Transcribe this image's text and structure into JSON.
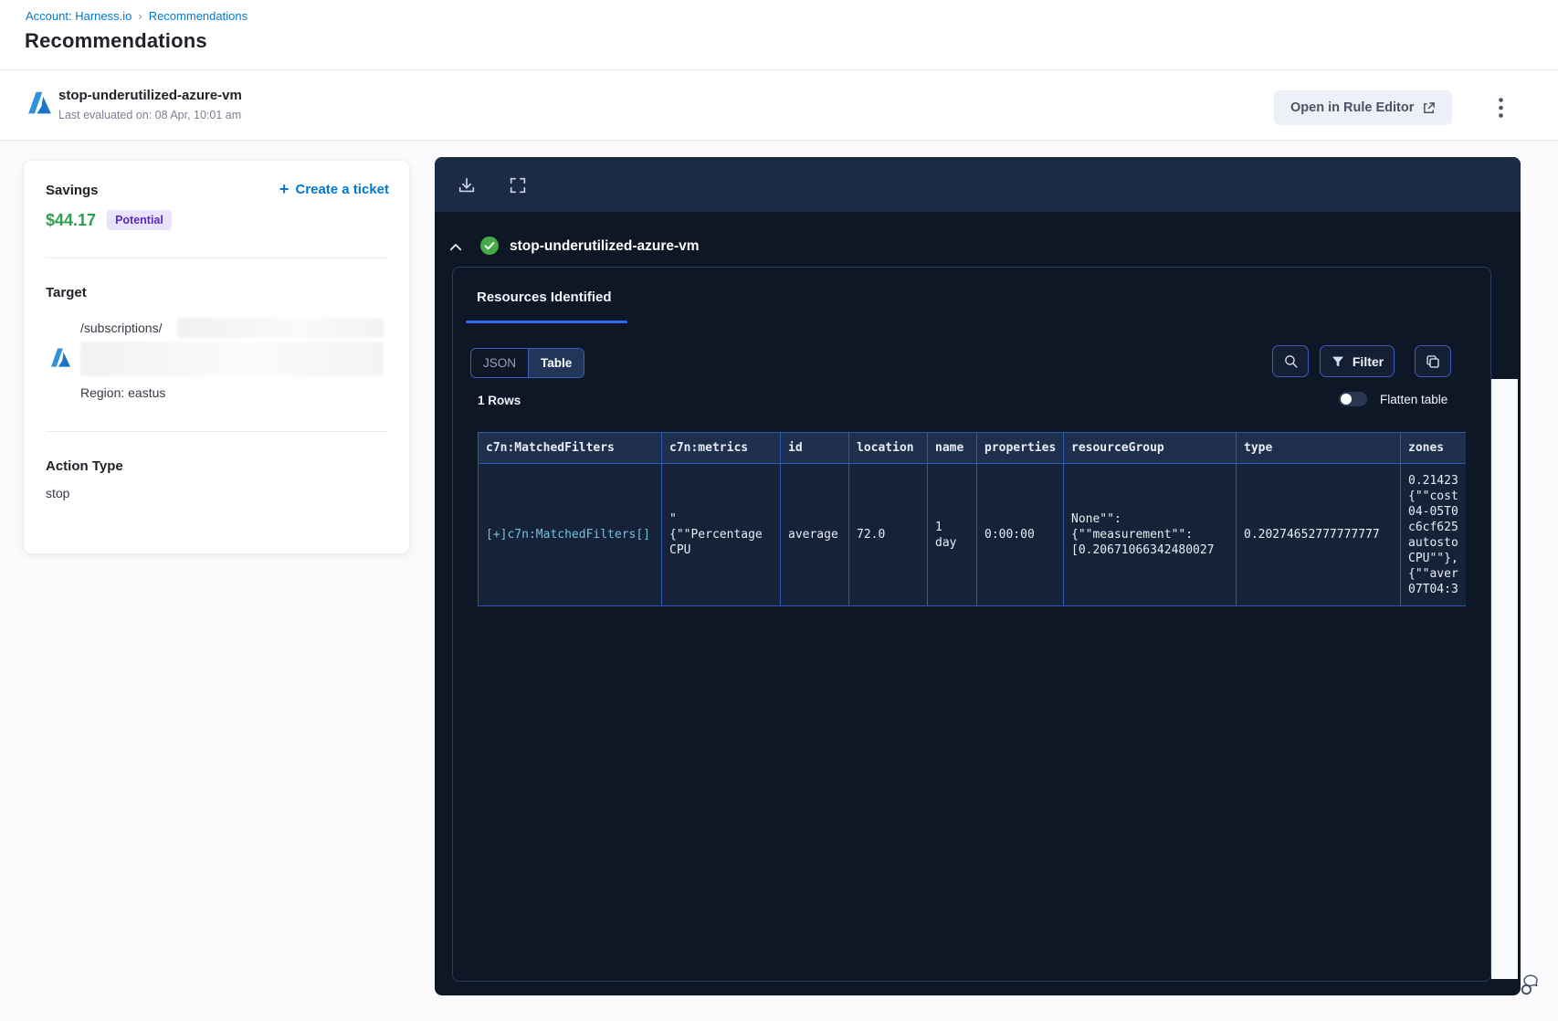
{
  "breadcrumb": {
    "account_label": "Account: Harness.io",
    "separator": "›",
    "current_label": "Recommendations"
  },
  "page": {
    "title": "Recommendations"
  },
  "header": {
    "rule_name": "stop-underutilized-azure-vm",
    "last_evaluated": "Last evaluated on: 08 Apr, 10:01 am",
    "open_rule_editor_label": "Open in Rule Editor"
  },
  "details_card": {
    "savings_label": "Savings",
    "savings_amount": "$44.17",
    "savings_badge": "Potential",
    "create_ticket_label": "Create a ticket",
    "plus_glyph": "+",
    "target_label": "Target",
    "target_path": "/subscriptions/",
    "region_label": "Region: eastus",
    "action_type_label": "Action Type",
    "action_type_value": "stop"
  },
  "results_panel": {
    "rule_name": "stop-underutilized-azure-vm",
    "tab_label": "Resources Identified",
    "view_json_label": "JSON",
    "view_table_label": "Table",
    "selected_view": "Table",
    "filter_label": "Filter",
    "rows_count_label": "1 Rows",
    "flatten_label": "Flatten table",
    "flatten_on": false,
    "table": {
      "columns": [
        "c7n:MatchedFilters",
        "c7n:metrics",
        "id",
        "location",
        "name",
        "properties",
        "resourceGroup",
        "type",
        "zones"
      ],
      "rows": [
        [
          "[+]c7n:MatchedFilters[]",
          "\"\n{\"\"Percentage\nCPU",
          "average",
          "72.0",
          "1\nday",
          "0:00:00",
          "None\"\":\n{\"\"measurement\"\":\n[0.20671066342480027",
          "0.20274652777777777",
          "0.21423\n{\"\"cost\n04-05T0\nc6cf625\nautosto\nCPU\"\"},\n{\"\"aver\n07T04:3"
        ]
      ]
    }
  },
  "colors": {
    "accent_blue": "#0278d5",
    "savings_green": "#2f9e4f",
    "badge_purple_bg": "#e9e3fb",
    "badge_purple_text": "#5c2bbf",
    "panel_bg": "#0e1726",
    "panel_toolbar_bg": "#1c2b45",
    "table_border_blue": "#2b59b4",
    "tab_underline_blue": "#3168f6",
    "success_green": "#42ab45"
  }
}
